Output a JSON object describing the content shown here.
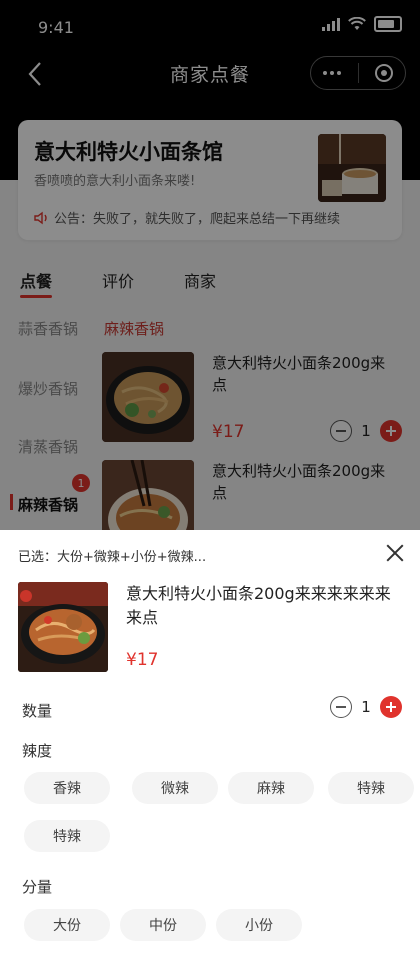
{
  "status_bar": {
    "time": "9:41"
  },
  "nav": {
    "title": "商家点餐"
  },
  "shop": {
    "name": "意大利特火小面条馆",
    "desc": "香喷喷的意大利小面条来喽!",
    "notice": "公告：失败了，就失败了，爬起来总结一下再继续"
  },
  "tabs": [
    {
      "label": "点餐",
      "active": true
    },
    {
      "label": "评价",
      "active": false
    },
    {
      "label": "商家",
      "active": false
    }
  ],
  "categories": [
    {
      "label": "蒜香香锅",
      "active": false
    },
    {
      "label": "爆炒香锅",
      "active": false
    },
    {
      "label": "清蒸香锅",
      "active": false
    },
    {
      "label": "麻辣香锅",
      "active": true,
      "badge": "1"
    }
  ],
  "section_title": "麻辣香锅",
  "dishes": [
    {
      "name": "意大利特火小面条200g来点",
      "price": "¥17",
      "quantity": "1"
    },
    {
      "name": "意大利特火小面条200g来点",
      "price": "",
      "quantity": ""
    }
  ],
  "sheet": {
    "selected": "已选：大份+微辣+小份+微辣...",
    "name": "意大利特火小面条200g来来来来来来来点",
    "price": "¥17",
    "quantity_label": "数量",
    "quantity": "1",
    "spice_label": "辣度",
    "spice_options": [
      "香辣",
      "微辣",
      "麻辣",
      "特辣",
      "特辣"
    ],
    "size_label": "分量",
    "size_options": [
      "大份",
      "中份",
      "小份"
    ]
  },
  "colors": {
    "accent": "#e0332d",
    "section_red": "#c73a33"
  }
}
